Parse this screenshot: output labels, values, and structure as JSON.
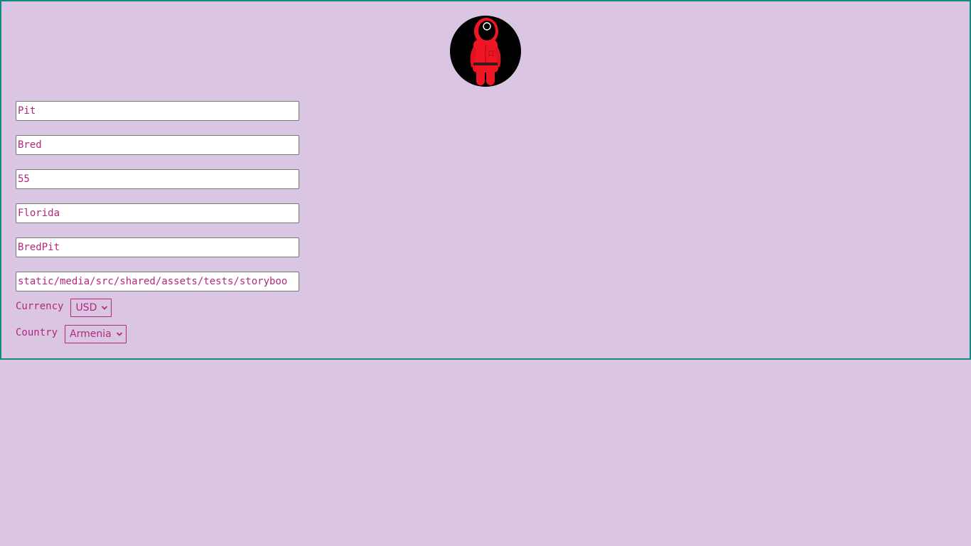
{
  "profile": {
    "avatar_icon": "squid-game-guard-icon",
    "colors": {
      "background": "#dac6e2",
      "border": "#0f8a82",
      "text": "#b3287e"
    },
    "fields": [
      {
        "name": "first-name",
        "value": "Pit"
      },
      {
        "name": "last-name",
        "value": "Bred"
      },
      {
        "name": "age",
        "value": "55"
      },
      {
        "name": "city",
        "value": "Florida"
      },
      {
        "name": "username",
        "value": "BredPit"
      },
      {
        "name": "avatar-path",
        "value": "static/media/src/shared/assets/tests/storyboo"
      }
    ],
    "currency": {
      "label": "Currency",
      "selected": "USD"
    },
    "country": {
      "label": "Country",
      "selected": "Armenia"
    }
  }
}
